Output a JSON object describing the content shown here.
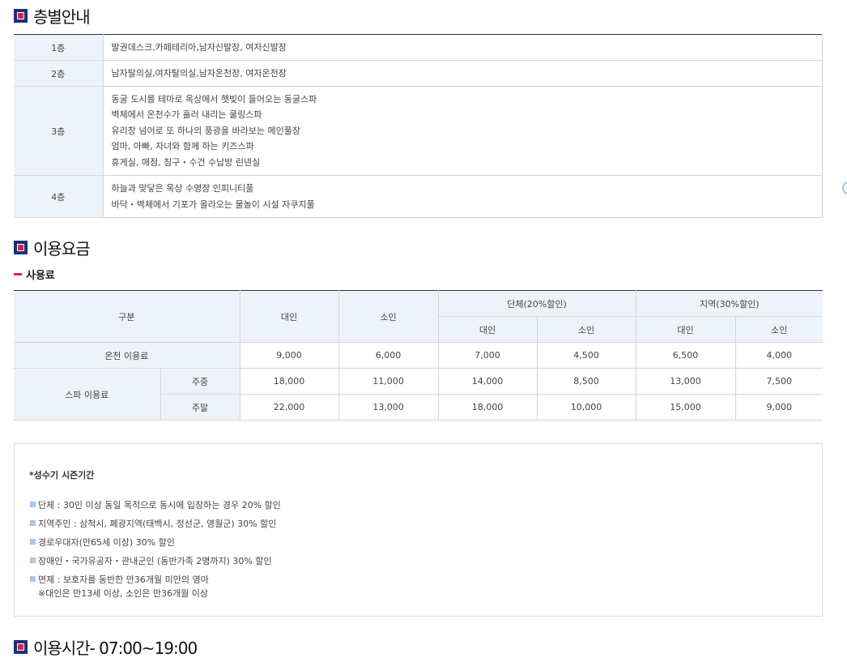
{
  "floor_guide": {
    "title": "층별안내",
    "rows": [
      {
        "floor": "1층",
        "lines": [
          "발권데스크,카페테리아,남자신발장, 여자신발장"
        ]
      },
      {
        "floor": "2층",
        "lines": [
          "남자탈의실,여자탈의실,남자온천장, 여자온천장"
        ]
      },
      {
        "floor": "3층",
        "lines": [
          "동굴 도시를 테마로 옥상에서 햇빛이 들어오는 동굴스파",
          "벽체에서 온천수가 흘러 내리는 쿨링스파",
          "유리창 넘어로 또 하나의 풍광을 바라보는 메인풀장",
          "엄마, 아빠, 자녀와 함께 하는 키즈스파",
          "휴게실, 매점, 침구・수건 수납방 린넨실"
        ]
      },
      {
        "floor": "4층",
        "lines": [
          "하늘과 맞닿은 옥상 수영장 인피니티풀",
          "바닥・벽체에서 기포가 올라오는 물놀이 시설 자쿠지풀"
        ]
      }
    ]
  },
  "fees": {
    "title": "이용요금",
    "subtitle": "사용료",
    "headers": {
      "category": "구분",
      "adult": "대인",
      "child": "소인",
      "group": "단체(20%할인)",
      "local": "지역(30%할인)",
      "group_adult": "대인",
      "group_child": "소인",
      "local_adult": "대인",
      "local_child": "소인"
    },
    "hot_spring": {
      "label": "온천 이용료",
      "values": [
        "9,000",
        "6,000",
        "7,000",
        "4,500",
        "6,500",
        "4,000"
      ]
    },
    "spa": {
      "label": "스파 이용료",
      "weekday": {
        "label": "주중",
        "values": [
          "18,000",
          "11,000",
          "14,000",
          "8,500",
          "13,000",
          "7,500"
        ]
      },
      "weekend": {
        "label": "주말",
        "values": [
          "22,000",
          "13,000",
          "18,000",
          "10,000",
          "15,000",
          "9,000"
        ]
      }
    }
  },
  "notes": {
    "head": "*성수기 시즌기간",
    "items": [
      "단체 : 30인 이상 동일 목적으로 동시에 입장하는 경우 20% 할인",
      "지역주민 : 삼척시, 폐광지역(태백시, 정선군, 영월군) 30% 할인",
      "경로우대자(만65세 이상) 30% 할인",
      "장애인・국가유공자・관내군인 (동반가족 2명까지) 30% 할인",
      "면제 : 보호자를 동반한 만36개월 미만의 영아"
    ],
    "sub": "※대인은 만13세 이상, 소인은 만36개월 이상",
    "bullet": "▩"
  },
  "hours": {
    "title": "이용시간- 07:00~19:00"
  }
}
